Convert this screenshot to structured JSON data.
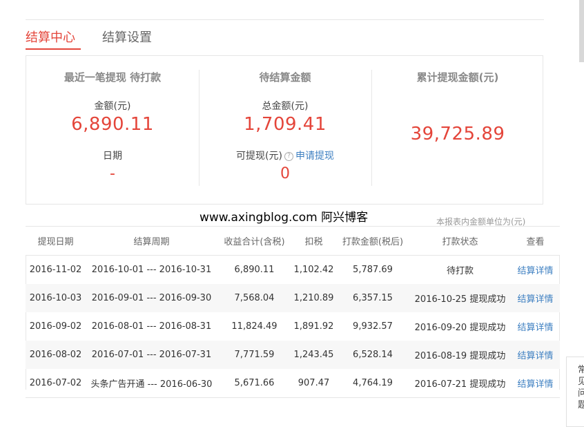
{
  "tabs": [
    {
      "label": "结算中心",
      "active": true
    },
    {
      "label": "结算设置",
      "active": false
    }
  ],
  "summary": {
    "recent": {
      "heading": "最近一笔提现 待打款",
      "amount_label": "金额(元)",
      "amount_value": "6,890.11",
      "date_label": "日期",
      "date_value": "-"
    },
    "pending": {
      "heading": "待结算金额",
      "total_label": "总金额(元)",
      "total_value": "1,709.41",
      "withdrawable_label": "可提现(元)",
      "help_icon": "?",
      "apply_link": "申请提现",
      "withdrawable_value": "0"
    },
    "cumulative": {
      "heading": "累计提现金额(元)",
      "value": "39,725.89"
    }
  },
  "watermark": "www.axingblog.com 阿兴博客",
  "unit_note": "本报表内金额单位为(元)",
  "table": {
    "headers": [
      "提现日期",
      "结算周期",
      "收益合计(含税)",
      "扣税",
      "打款金额(税后)",
      "打款状态",
      "查看"
    ],
    "rows": [
      {
        "date": "2016-11-02",
        "period": "2016-10-01 --- 2016-10-31",
        "income": "6,890.11",
        "tax": "1,102.42",
        "payout": "5,787.69",
        "status": "待打款",
        "detail": "结算详情"
      },
      {
        "date": "2016-10-03",
        "period": "2016-09-01 --- 2016-09-30",
        "income": "7,568.04",
        "tax": "1,210.89",
        "payout": "6,357.15",
        "status": "2016-10-25 提现成功",
        "detail": "结算详情"
      },
      {
        "date": "2016-09-02",
        "period": "2016-08-01 --- 2016-08-31",
        "income": "11,824.49",
        "tax": "1,891.92",
        "payout": "9,932.57",
        "status": "2016-09-20 提现成功",
        "detail": "结算详情"
      },
      {
        "date": "2016-08-02",
        "period": "2016-07-01 --- 2016-07-31",
        "income": "7,771.59",
        "tax": "1,243.45",
        "payout": "6,528.14",
        "status": "2016-08-19 提现成功",
        "detail": "结算详情"
      },
      {
        "date": "2016-07-02",
        "period": "头条广告开通 --- 2016-06-30",
        "income": "5,671.66",
        "tax": "907.47",
        "payout": "4,764.19",
        "status": "2016-07-21 提现成功",
        "detail": "结算详情"
      }
    ]
  },
  "side_panel": {
    "text": "常见问题"
  },
  "colors": {
    "accent": "#e4453a",
    "link": "#3d7fc1",
    "border": "#e6e6e6"
  }
}
